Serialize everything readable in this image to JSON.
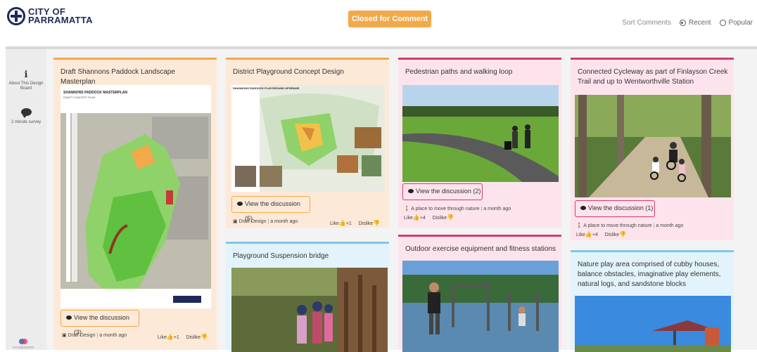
{
  "header": {
    "logo_line1": "CITY OF",
    "logo_line2": "PARRAMATTA",
    "status": "Closed for Comment",
    "sort_label": "Sort Comments",
    "sort_options": [
      "Recent",
      "Popular"
    ]
  },
  "sidebar": {
    "items": [
      {
        "label": "About This Design Board",
        "icon": "info-icon"
      },
      {
        "label": "2 minute survey",
        "icon": "chat-bubble-icon"
      }
    ],
    "powered_by": "socialpinpoint"
  },
  "cards": [
    {
      "title": "Draft Shannons Paddock Landscape Masterplan",
      "image_caption": "SHANNONS PADDOCK MASTERPLAN",
      "image_subcaption": "DRAFT CONCEPT PLAN",
      "button": "View the discussion (3)",
      "category": "Draft Design",
      "time": "a month ago",
      "like": "Like",
      "like_count": "+1",
      "dislike": "Dislike"
    },
    {
      "title": "District Playground Concept Design",
      "image_caption": "SHANNONS PADDOCK PLAYGROUND UPGRADE",
      "button": "View the discussion (5)",
      "category": "Draft Design",
      "time": "a month ago",
      "like": "Like",
      "like_count": "+1",
      "dislike": "Dislike"
    },
    {
      "title": "Pedestrian paths and walking loop",
      "button": "View the discussion (2)",
      "category": "A place to move through nature",
      "time": "a month ago",
      "like": "Like",
      "like_count": "+4",
      "dislike": "Dislike"
    },
    {
      "title": "Connected Cycleway as part of Finlayson Creek Trail and up to Wentworthville Station",
      "button": "View the discussion (1)",
      "category": "A place to move through nature",
      "time": "a month ago",
      "like": "Like",
      "like_count": "+4",
      "dislike": "Dislike"
    },
    {
      "title": "Playground Suspension bridge"
    },
    {
      "title": "Outdoor exercise equipment and fitness stations"
    },
    {
      "title": "Nature play area comprised of cubby houses, balance obstacles, imaginative play elements, natural logs, and sandstone blocks"
    }
  ],
  "colors": {
    "orange": "#f2a94a",
    "pink": "#d63a6e",
    "blue": "#7fc6ea",
    "navy": "#1e2a5a"
  }
}
